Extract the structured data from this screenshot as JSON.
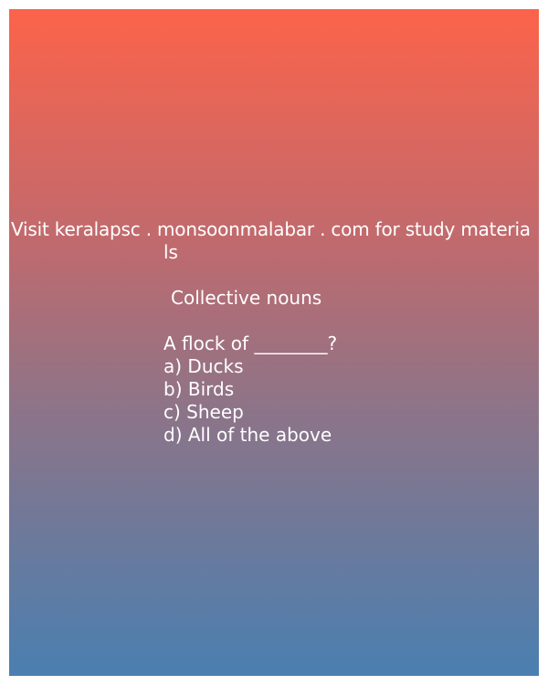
{
  "card": {
    "site_line": "Visit keralapsc . monsoonmalabar . com for study materia",
    "site_line_cont": "ls",
    "heading": "Collective nouns",
    "question": "A flock of ________?",
    "options": [
      "a) Ducks",
      "b) Birds",
      "c) Sheep",
      "d) All of the above"
    ]
  },
  "colors": {
    "gradient_top": "#fc634a",
    "gradient_bottom": "#4a7fb0",
    "text": "#ffffff"
  }
}
